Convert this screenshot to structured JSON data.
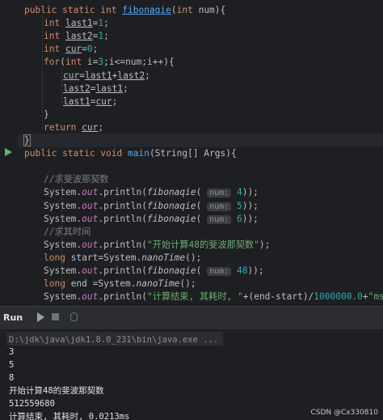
{
  "editor": {
    "lines": [
      {
        "indent": 1,
        "tokens": [
          {
            "t": "public static int ",
            "c": "kw"
          },
          {
            "t": "fibonaqie",
            "c": "fn"
          },
          {
            "t": "(",
            "c": ""
          },
          {
            "t": "int ",
            "c": "kw"
          },
          {
            "t": "num){",
            "c": ""
          }
        ]
      },
      {
        "indent": 2,
        "tokens": [
          {
            "t": "int ",
            "c": "kw"
          },
          {
            "t": "last1",
            "c": "var"
          },
          {
            "t": "=",
            "c": ""
          },
          {
            "t": "1",
            "c": "num"
          },
          {
            "t": ";",
            "c": ""
          }
        ]
      },
      {
        "indent": 2,
        "tokens": [
          {
            "t": "int ",
            "c": "kw"
          },
          {
            "t": "last2",
            "c": "var"
          },
          {
            "t": "=",
            "c": ""
          },
          {
            "t": "1",
            "c": "num"
          },
          {
            "t": ";",
            "c": ""
          }
        ]
      },
      {
        "indent": 2,
        "tokens": [
          {
            "t": "int ",
            "c": "kw"
          },
          {
            "t": "cur",
            "c": "var"
          },
          {
            "t": "=",
            "c": ""
          },
          {
            "t": "0",
            "c": "num"
          },
          {
            "t": ";",
            "c": ""
          }
        ]
      },
      {
        "indent": 2,
        "tokens": [
          {
            "t": "for",
            "c": "kw"
          },
          {
            "t": "(",
            "c": ""
          },
          {
            "t": "int ",
            "c": "kw"
          },
          {
            "t": "i=",
            "c": ""
          },
          {
            "t": "3",
            "c": "num"
          },
          {
            "t": ";i<=num;i++){",
            "c": ""
          }
        ]
      },
      {
        "indent": 3,
        "tokens": [
          {
            "t": "cur",
            "c": "var"
          },
          {
            "t": "=",
            "c": ""
          },
          {
            "t": "last1",
            "c": "var"
          },
          {
            "t": "+",
            "c": ""
          },
          {
            "t": "last2",
            "c": "var"
          },
          {
            "t": ";",
            "c": ""
          }
        ]
      },
      {
        "indent": 3,
        "tokens": [
          {
            "t": "last2",
            "c": "var"
          },
          {
            "t": "=",
            "c": ""
          },
          {
            "t": "last1",
            "c": "var"
          },
          {
            "t": ";",
            "c": ""
          }
        ]
      },
      {
        "indent": 3,
        "tokens": [
          {
            "t": "last1",
            "c": "var"
          },
          {
            "t": "=",
            "c": ""
          },
          {
            "t": "cur",
            "c": "var"
          },
          {
            "t": ";",
            "c": ""
          }
        ]
      },
      {
        "indent": 2,
        "tokens": [
          {
            "t": "}",
            "c": ""
          }
        ]
      },
      {
        "indent": 2,
        "tokens": [
          {
            "t": "return ",
            "c": "kw"
          },
          {
            "t": "cur",
            "c": "var"
          },
          {
            "t": ";",
            "c": ""
          }
        ]
      },
      {
        "indent": 1,
        "tokens": [
          {
            "t": "}",
            "c": "brace-hl"
          }
        ]
      },
      {
        "indent": 1,
        "tokens": [
          {
            "t": "public static void ",
            "c": "kw"
          },
          {
            "t": "main",
            "c": "fnp"
          },
          {
            "t": "(String[] Args){",
            "c": ""
          }
        ]
      },
      {
        "indent": 1,
        "tokens": []
      },
      {
        "indent": 2,
        "tokens": [
          {
            "t": "//求斐波那契数",
            "c": "cmt"
          }
        ]
      },
      {
        "indent": 2,
        "tokens": [
          {
            "t": "System.",
            "c": ""
          },
          {
            "t": "out",
            "c": "fld"
          },
          {
            "t": ".println(",
            "c": ""
          },
          {
            "t": "fibonaqie",
            "c": "ital"
          },
          {
            "t": "( ",
            "c": ""
          },
          {
            "t": "num:",
            "c": "hint"
          },
          {
            "t": " ",
            "c": ""
          },
          {
            "t": "4",
            "c": "num"
          },
          {
            "t": "));",
            "c": ""
          }
        ]
      },
      {
        "indent": 2,
        "tokens": [
          {
            "t": "System.",
            "c": ""
          },
          {
            "t": "out",
            "c": "fld"
          },
          {
            "t": ".println(",
            "c": ""
          },
          {
            "t": "fibonaqie",
            "c": "ital"
          },
          {
            "t": "( ",
            "c": ""
          },
          {
            "t": "num:",
            "c": "hint"
          },
          {
            "t": " ",
            "c": ""
          },
          {
            "t": "5",
            "c": "num"
          },
          {
            "t": "));",
            "c": ""
          }
        ]
      },
      {
        "indent": 2,
        "tokens": [
          {
            "t": "System.",
            "c": ""
          },
          {
            "t": "out",
            "c": "fld"
          },
          {
            "t": ".println(",
            "c": ""
          },
          {
            "t": "fibonaqie",
            "c": "ital"
          },
          {
            "t": "( ",
            "c": ""
          },
          {
            "t": "num:",
            "c": "hint"
          },
          {
            "t": " ",
            "c": ""
          },
          {
            "t": "6",
            "c": "num"
          },
          {
            "t": "));",
            "c": ""
          }
        ]
      },
      {
        "indent": 2,
        "tokens": [
          {
            "t": "//求其时间",
            "c": "cmt"
          }
        ]
      },
      {
        "indent": 2,
        "tokens": [
          {
            "t": "System.",
            "c": ""
          },
          {
            "t": "out",
            "c": "fld"
          },
          {
            "t": ".println(",
            "c": ""
          },
          {
            "t": "\"开始计算48的斐波那契数\"",
            "c": "str"
          },
          {
            "t": ");",
            "c": ""
          }
        ]
      },
      {
        "indent": 2,
        "tokens": [
          {
            "t": "long ",
            "c": "kw"
          },
          {
            "t": "start=System.",
            "c": ""
          },
          {
            "t": "nanoTime",
            "c": "ital"
          },
          {
            "t": "();",
            "c": ""
          }
        ]
      },
      {
        "indent": 2,
        "tokens": [
          {
            "t": "System.",
            "c": ""
          },
          {
            "t": "out",
            "c": "fld"
          },
          {
            "t": ".println(",
            "c": ""
          },
          {
            "t": "fibonaqie",
            "c": "ital"
          },
          {
            "t": "( ",
            "c": ""
          },
          {
            "t": "num:",
            "c": "hint"
          },
          {
            "t": " ",
            "c": ""
          },
          {
            "t": "48",
            "c": "num"
          },
          {
            "t": "));",
            "c": ""
          }
        ]
      },
      {
        "indent": 2,
        "tokens": [
          {
            "t": "long ",
            "c": "kw"
          },
          {
            "t": "end =System.",
            "c": ""
          },
          {
            "t": "nanoTime",
            "c": "ital"
          },
          {
            "t": "();",
            "c": ""
          }
        ]
      },
      {
        "indent": 2,
        "tokens": [
          {
            "t": "System.",
            "c": ""
          },
          {
            "t": "out",
            "c": "fld"
          },
          {
            "t": ".println(",
            "c": ""
          },
          {
            "t": "\"计算结束, 其耗时, \"",
            "c": "str"
          },
          {
            "t": "+(end-start)/",
            "c": ""
          },
          {
            "t": "1000000.0",
            "c": "num"
          },
          {
            "t": "+",
            "c": ""
          },
          {
            "t": "\"ms\"",
            "c": "str"
          },
          {
            "t": ");",
            "c": ""
          }
        ]
      }
    ]
  },
  "run_panel": {
    "label": "Run",
    "buttons": [
      "rerun-icon",
      "stop-icon",
      "debug-icon"
    ]
  },
  "console": {
    "lines": [
      "D:\\jdk\\java\\jdk1.8.0_231\\bin\\java.exe ...",
      "3",
      "5",
      "8",
      "开始计算48的斐波那契数",
      "512559680",
      "计算结束, 其耗时, 0.0213ms"
    ]
  },
  "watermark": "CSDN @Cx330810"
}
